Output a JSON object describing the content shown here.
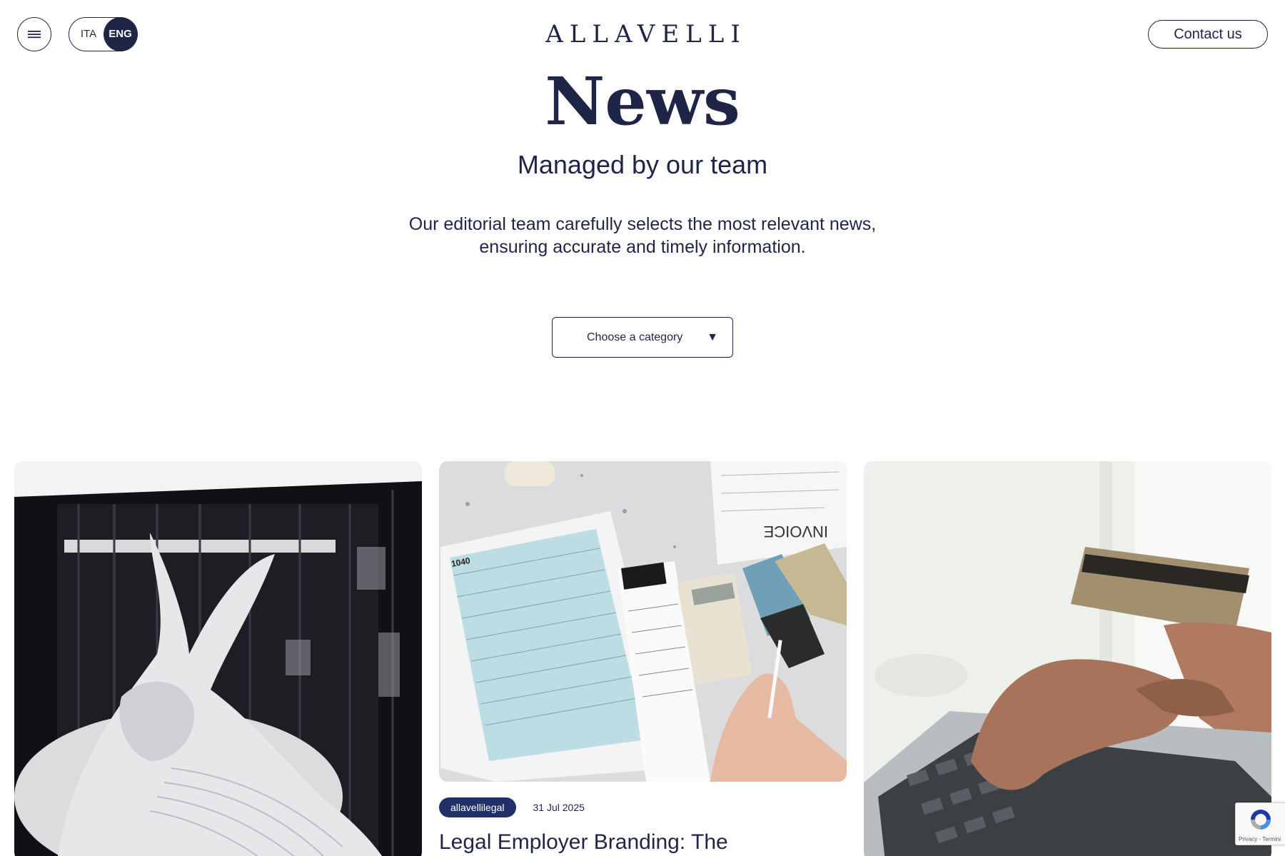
{
  "header": {
    "logo_text": "ALLAVELLI",
    "lang_ita": "ITA",
    "lang_eng": "ENG",
    "active_language": "ENG",
    "contact_label": "Contact us"
  },
  "hero": {
    "title": "News",
    "subtitle": "Managed by our team",
    "description_line1": "Our editorial team carefully selects the most relevant news,",
    "description_line2": "ensuring accurate and timely information."
  },
  "filter": {
    "category_label": "Choose a category",
    "arrow": "▼"
  },
  "cards": [
    {
      "image": "sculpture-photo",
      "category": "",
      "date": "",
      "title": ""
    },
    {
      "image": "tax-documents-photo",
      "category": "allavellilegal",
      "date": "31 Jul 2025",
      "title": "Legal Employer Branding: The"
    },
    {
      "image": "credit-card-laptop-photo",
      "category": "",
      "date": "",
      "title": ""
    }
  ],
  "recaptcha": {
    "text": "Privacy - Termini"
  },
  "colors": {
    "primary": "#1f2547",
    "badge": "#22306a",
    "background": "#ffffff"
  }
}
